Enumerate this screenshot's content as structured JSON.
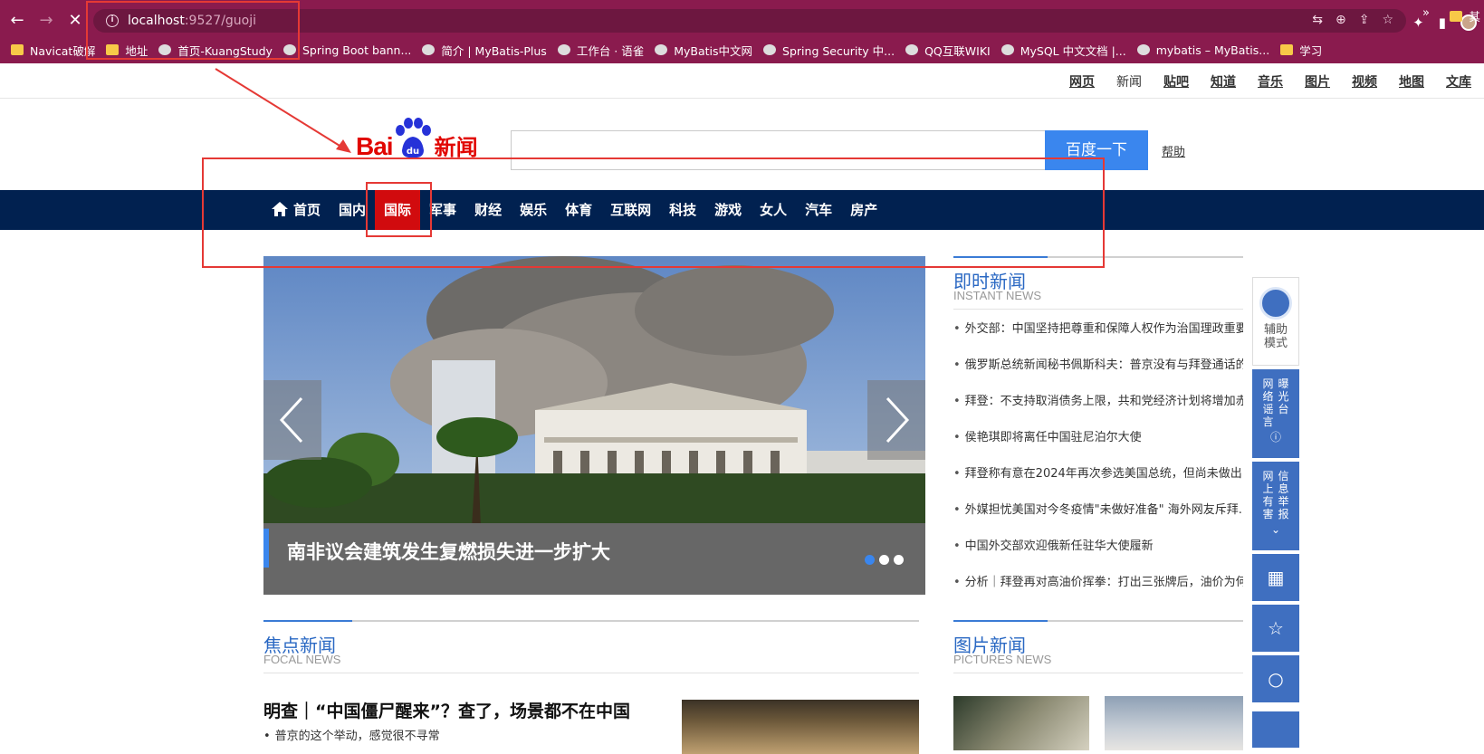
{
  "browser": {
    "url_host": "localhost",
    "url_rest": ":9527/guoji",
    "nav": {
      "back": "←",
      "forward": "→",
      "stop": "✕"
    },
    "omnibox_icons": [
      "translate-icon",
      "zoom-icon",
      "share-icon",
      "star-icon"
    ],
    "bookmarks": [
      {
        "label": "Navicat破解",
        "icon": "folder"
      },
      {
        "label": "地址",
        "icon": "folder"
      },
      {
        "label": "首页-KuangStudy",
        "icon": "site"
      },
      {
        "label": "Spring Boot bann...",
        "icon": "site"
      },
      {
        "label": "简介 | MyBatis-Plus",
        "icon": "site"
      },
      {
        "label": "工作台 · 语雀",
        "icon": "site"
      },
      {
        "label": "MyBatis中文网",
        "icon": "site"
      },
      {
        "label": "Spring Security 中...",
        "icon": "site"
      },
      {
        "label": "QQ互联WIKI",
        "icon": "site"
      },
      {
        "label": "MySQL 中文文档 |...",
        "icon": "site"
      },
      {
        "label": "mybatis – MyBatis...",
        "icon": "site"
      },
      {
        "label": "学习",
        "icon": "folder"
      }
    ],
    "bookmarks_more": "»",
    "bookmarks_last": "其"
  },
  "top_links": [
    "网页",
    "新闻",
    "贴吧",
    "知道",
    "音乐",
    "图片",
    "视频",
    "地图",
    "文库"
  ],
  "top_links_current": "新闻",
  "logo": {
    "bai": "Bai",
    "news": "新闻"
  },
  "search": {
    "button": "百度一下",
    "help": "帮助",
    "placeholder": ""
  },
  "channels": [
    {
      "label": "首页",
      "active": false
    },
    {
      "label": "国内",
      "active": false
    },
    {
      "label": "国际",
      "active": true
    },
    {
      "label": "军事",
      "active": false
    },
    {
      "label": "财经",
      "active": false
    },
    {
      "label": "娱乐",
      "active": false
    },
    {
      "label": "体育",
      "active": false
    },
    {
      "label": "互联网",
      "active": false
    },
    {
      "label": "科技",
      "active": false
    },
    {
      "label": "游戏",
      "active": false
    },
    {
      "label": "女人",
      "active": false
    },
    {
      "label": "汽车",
      "active": false
    },
    {
      "label": "房产",
      "active": false
    }
  ],
  "slider": {
    "caption": "南非议会建筑发生复燃损失进一步扩大",
    "dots": 3,
    "active_dot": 0
  },
  "instant_news": {
    "title": "即时新闻",
    "subtitle": "INSTANT NEWS",
    "items": [
      "外交部：中国坚持把尊重和保障人权作为治国理政重要",
      "俄罗斯总统新闻秘书佩斯科夫：普京没有与拜登通话的",
      "拜登：不支持取消债务上限，共和党经济计划将增加赤",
      "侯艳琪即将离任中国驻尼泊尔大使",
      "拜登称有意在2024年再次参选美国总统，但尚未做出...",
      "外媒担忧美国对今冬疫情\"未做好准备\" 海外网友斥拜...",
      "中国外交部欢迎俄新任驻华大使履新",
      "分析｜拜登再对高油价挥拳：打出三张牌后，油价为何"
    ]
  },
  "tools": {
    "a11y": "辅助模式",
    "report1": [
      "网络谣言",
      "曝光台"
    ],
    "report2": [
      "网上有害",
      "信息举报"
    ]
  },
  "focal_news": {
    "title": "焦点新闻",
    "subtitle": "FOCAL NEWS",
    "headline": "明查｜“中国僵尸醒来”？查了，场景都不在中国",
    "sub": "普京的这个举动，感觉很不寻常"
  },
  "pictures_news": {
    "title": "图片新闻",
    "subtitle": "PICTURES NEWS"
  },
  "colors": {
    "browser": "#8a1b4e",
    "channel_nav": "#012150",
    "active_channel": "#d10b0e",
    "search_button": "#3a86ee",
    "annotation": "#e53935"
  }
}
